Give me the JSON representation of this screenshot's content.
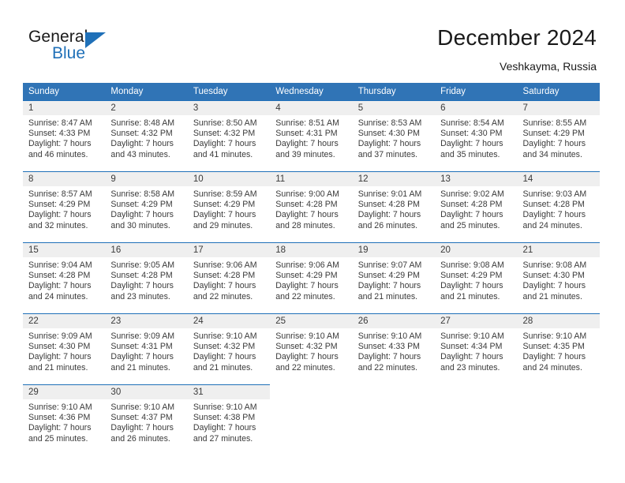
{
  "brand": {
    "word_one": "General",
    "word_two": "Blue",
    "triangle_icon": "brand-triangle-icon",
    "accent_color": "#1f70b8"
  },
  "header": {
    "title": "December 2024",
    "subtitle": "Veshkayma, Russia"
  },
  "calendar": {
    "header_bg": "#3074b6",
    "date_strip_bg": "#efefef",
    "cell_rule_color": "#1f70b8",
    "weekday_headers": [
      "Sunday",
      "Monday",
      "Tuesday",
      "Wednesday",
      "Thursday",
      "Friday",
      "Saturday"
    ],
    "weeks": [
      [
        {
          "day": "1",
          "sunrise": "Sunrise: 8:47 AM",
          "sunset": "Sunset: 4:33 PM",
          "daylight_line1": "Daylight: 7 hours",
          "daylight_line2": "and 46 minutes."
        },
        {
          "day": "2",
          "sunrise": "Sunrise: 8:48 AM",
          "sunset": "Sunset: 4:32 PM",
          "daylight_line1": "Daylight: 7 hours",
          "daylight_line2": "and 43 minutes."
        },
        {
          "day": "3",
          "sunrise": "Sunrise: 8:50 AM",
          "sunset": "Sunset: 4:32 PM",
          "daylight_line1": "Daylight: 7 hours",
          "daylight_line2": "and 41 minutes."
        },
        {
          "day": "4",
          "sunrise": "Sunrise: 8:51 AM",
          "sunset": "Sunset: 4:31 PM",
          "daylight_line1": "Daylight: 7 hours",
          "daylight_line2": "and 39 minutes."
        },
        {
          "day": "5",
          "sunrise": "Sunrise: 8:53 AM",
          "sunset": "Sunset: 4:30 PM",
          "daylight_line1": "Daylight: 7 hours",
          "daylight_line2": "and 37 minutes."
        },
        {
          "day": "6",
          "sunrise": "Sunrise: 8:54 AM",
          "sunset": "Sunset: 4:30 PM",
          "daylight_line1": "Daylight: 7 hours",
          "daylight_line2": "and 35 minutes."
        },
        {
          "day": "7",
          "sunrise": "Sunrise: 8:55 AM",
          "sunset": "Sunset: 4:29 PM",
          "daylight_line1": "Daylight: 7 hours",
          "daylight_line2": "and 34 minutes."
        }
      ],
      [
        {
          "day": "8",
          "sunrise": "Sunrise: 8:57 AM",
          "sunset": "Sunset: 4:29 PM",
          "daylight_line1": "Daylight: 7 hours",
          "daylight_line2": "and 32 minutes."
        },
        {
          "day": "9",
          "sunrise": "Sunrise: 8:58 AM",
          "sunset": "Sunset: 4:29 PM",
          "daylight_line1": "Daylight: 7 hours",
          "daylight_line2": "and 30 minutes."
        },
        {
          "day": "10",
          "sunrise": "Sunrise: 8:59 AM",
          "sunset": "Sunset: 4:29 PM",
          "daylight_line1": "Daylight: 7 hours",
          "daylight_line2": "and 29 minutes."
        },
        {
          "day": "11",
          "sunrise": "Sunrise: 9:00 AM",
          "sunset": "Sunset: 4:28 PM",
          "daylight_line1": "Daylight: 7 hours",
          "daylight_line2": "and 28 minutes."
        },
        {
          "day": "12",
          "sunrise": "Sunrise: 9:01 AM",
          "sunset": "Sunset: 4:28 PM",
          "daylight_line1": "Daylight: 7 hours",
          "daylight_line2": "and 26 minutes."
        },
        {
          "day": "13",
          "sunrise": "Sunrise: 9:02 AM",
          "sunset": "Sunset: 4:28 PM",
          "daylight_line1": "Daylight: 7 hours",
          "daylight_line2": "and 25 minutes."
        },
        {
          "day": "14",
          "sunrise": "Sunrise: 9:03 AM",
          "sunset": "Sunset: 4:28 PM",
          "daylight_line1": "Daylight: 7 hours",
          "daylight_line2": "and 24 minutes."
        }
      ],
      [
        {
          "day": "15",
          "sunrise": "Sunrise: 9:04 AM",
          "sunset": "Sunset: 4:28 PM",
          "daylight_line1": "Daylight: 7 hours",
          "daylight_line2": "and 24 minutes."
        },
        {
          "day": "16",
          "sunrise": "Sunrise: 9:05 AM",
          "sunset": "Sunset: 4:28 PM",
          "daylight_line1": "Daylight: 7 hours",
          "daylight_line2": "and 23 minutes."
        },
        {
          "day": "17",
          "sunrise": "Sunrise: 9:06 AM",
          "sunset": "Sunset: 4:28 PM",
          "daylight_line1": "Daylight: 7 hours",
          "daylight_line2": "and 22 minutes."
        },
        {
          "day": "18",
          "sunrise": "Sunrise: 9:06 AM",
          "sunset": "Sunset: 4:29 PM",
          "daylight_line1": "Daylight: 7 hours",
          "daylight_line2": "and 22 minutes."
        },
        {
          "day": "19",
          "sunrise": "Sunrise: 9:07 AM",
          "sunset": "Sunset: 4:29 PM",
          "daylight_line1": "Daylight: 7 hours",
          "daylight_line2": "and 21 minutes."
        },
        {
          "day": "20",
          "sunrise": "Sunrise: 9:08 AM",
          "sunset": "Sunset: 4:29 PM",
          "daylight_line1": "Daylight: 7 hours",
          "daylight_line2": "and 21 minutes."
        },
        {
          "day": "21",
          "sunrise": "Sunrise: 9:08 AM",
          "sunset": "Sunset: 4:30 PM",
          "daylight_line1": "Daylight: 7 hours",
          "daylight_line2": "and 21 minutes."
        }
      ],
      [
        {
          "day": "22",
          "sunrise": "Sunrise: 9:09 AM",
          "sunset": "Sunset: 4:30 PM",
          "daylight_line1": "Daylight: 7 hours",
          "daylight_line2": "and 21 minutes."
        },
        {
          "day": "23",
          "sunrise": "Sunrise: 9:09 AM",
          "sunset": "Sunset: 4:31 PM",
          "daylight_line1": "Daylight: 7 hours",
          "daylight_line2": "and 21 minutes."
        },
        {
          "day": "24",
          "sunrise": "Sunrise: 9:10 AM",
          "sunset": "Sunset: 4:32 PM",
          "daylight_line1": "Daylight: 7 hours",
          "daylight_line2": "and 21 minutes."
        },
        {
          "day": "25",
          "sunrise": "Sunrise: 9:10 AM",
          "sunset": "Sunset: 4:32 PM",
          "daylight_line1": "Daylight: 7 hours",
          "daylight_line2": "and 22 minutes."
        },
        {
          "day": "26",
          "sunrise": "Sunrise: 9:10 AM",
          "sunset": "Sunset: 4:33 PM",
          "daylight_line1": "Daylight: 7 hours",
          "daylight_line2": "and 22 minutes."
        },
        {
          "day": "27",
          "sunrise": "Sunrise: 9:10 AM",
          "sunset": "Sunset: 4:34 PM",
          "daylight_line1": "Daylight: 7 hours",
          "daylight_line2": "and 23 minutes."
        },
        {
          "day": "28",
          "sunrise": "Sunrise: 9:10 AM",
          "sunset": "Sunset: 4:35 PM",
          "daylight_line1": "Daylight: 7 hours",
          "daylight_line2": "and 24 minutes."
        }
      ],
      [
        {
          "day": "29",
          "sunrise": "Sunrise: 9:10 AM",
          "sunset": "Sunset: 4:36 PM",
          "daylight_line1": "Daylight: 7 hours",
          "daylight_line2": "and 25 minutes."
        },
        {
          "day": "30",
          "sunrise": "Sunrise: 9:10 AM",
          "sunset": "Sunset: 4:37 PM",
          "daylight_line1": "Daylight: 7 hours",
          "daylight_line2": "and 26 minutes."
        },
        {
          "day": "31",
          "sunrise": "Sunrise: 9:10 AM",
          "sunset": "Sunset: 4:38 PM",
          "daylight_line1": "Daylight: 7 hours",
          "daylight_line2": "and 27 minutes."
        },
        {
          "day": "",
          "sunrise": "",
          "sunset": "",
          "daylight_line1": "",
          "daylight_line2": ""
        },
        {
          "day": "",
          "sunrise": "",
          "sunset": "",
          "daylight_line1": "",
          "daylight_line2": ""
        },
        {
          "day": "",
          "sunrise": "",
          "sunset": "",
          "daylight_line1": "",
          "daylight_line2": ""
        },
        {
          "day": "",
          "sunrise": "",
          "sunset": "",
          "daylight_line1": "",
          "daylight_line2": ""
        }
      ]
    ]
  }
}
